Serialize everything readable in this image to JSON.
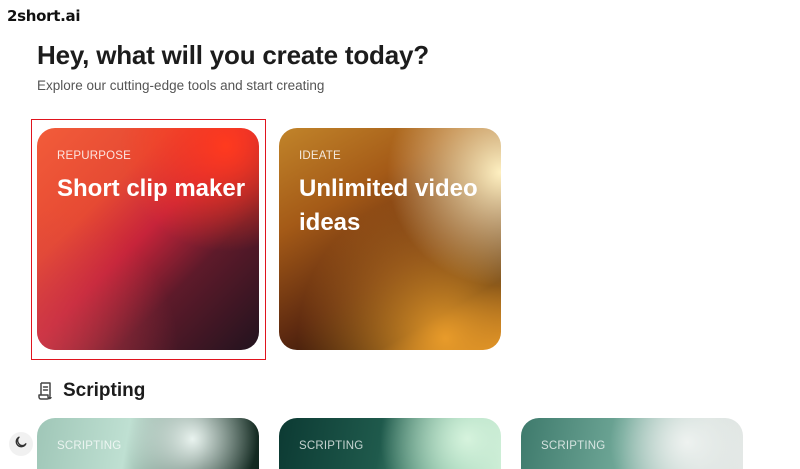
{
  "brand": {
    "logo_text": "2short.ai"
  },
  "hero": {
    "title": "Hey, what will you create today?",
    "subtitle": "Explore our cutting-edge tools and start creating"
  },
  "tool_cards": [
    {
      "tag": "REPURPOSE",
      "title": "Short clip maker"
    },
    {
      "tag": "IDEATE",
      "title": "Unlimited video ideas"
    }
  ],
  "scripting_section": {
    "title": "Scripting",
    "icon": "script-icon",
    "cards": [
      {
        "tag": "SCRIPTING"
      },
      {
        "tag": "SCRIPTING"
      },
      {
        "tag": "SCRIPTING"
      }
    ]
  },
  "theme_toggle": {
    "icon": "moon-icon"
  },
  "colors": {
    "selection_outline": "#e0141e",
    "text_primary": "#1c1c1c",
    "text_secondary": "#555555"
  }
}
